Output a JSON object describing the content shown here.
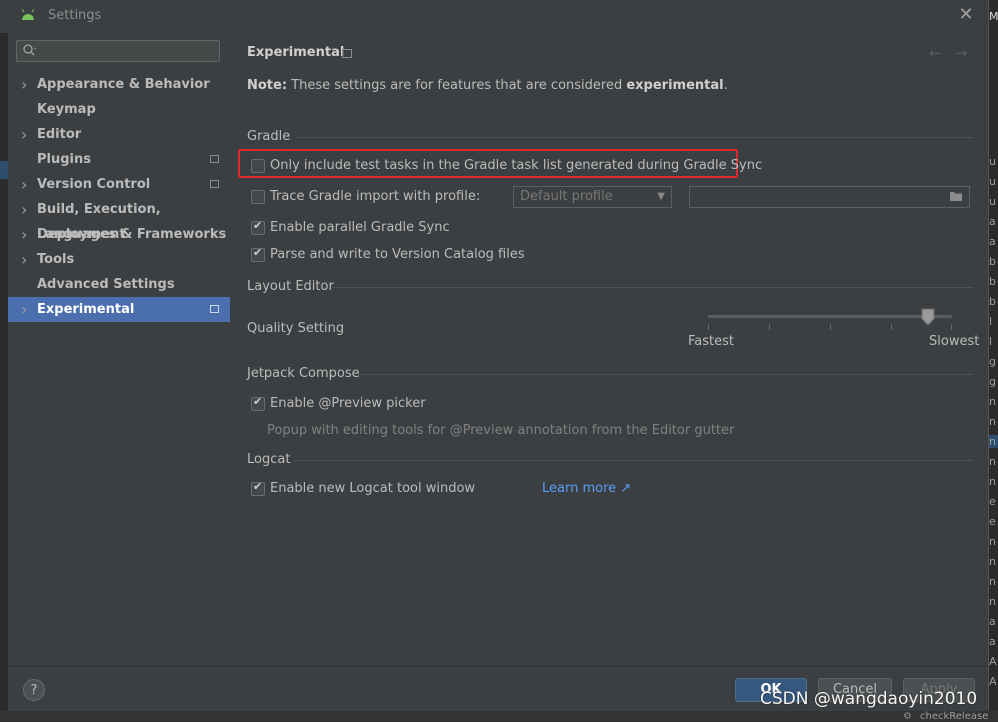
{
  "window": {
    "title": "Settings"
  },
  "sidebar": {
    "search_placeholder": "",
    "items": [
      {
        "label": "Appearance & Behavior",
        "expandable": true,
        "project": false
      },
      {
        "label": "Keymap",
        "expandable": false,
        "project": false
      },
      {
        "label": "Editor",
        "expandable": true,
        "project": false
      },
      {
        "label": "Plugins",
        "expandable": false,
        "project": true
      },
      {
        "label": "Version Control",
        "expandable": true,
        "project": true
      },
      {
        "label": "Build, Execution, Deployment",
        "expandable": true,
        "project": false
      },
      {
        "label": "Languages & Frameworks",
        "expandable": true,
        "project": false
      },
      {
        "label": "Tools",
        "expandable": true,
        "project": false
      },
      {
        "label": "Advanced Settings",
        "expandable": false,
        "project": false
      },
      {
        "label": "Experimental",
        "expandable": true,
        "project": true,
        "selected": true
      }
    ]
  },
  "page": {
    "title": "Experimental",
    "note_label": "Note:",
    "note_text": " These settings are for features that are considered ",
    "note_emph": "experimental",
    "note_end": "."
  },
  "gradle": {
    "section": "Gradle",
    "only_test_tasks": {
      "label": "Only include test tasks in the Gradle task list generated during Gradle Sync",
      "checked": false
    },
    "trace_import": {
      "label": "Trace Gradle import with profile:",
      "checked": false
    },
    "profile_dropdown": "Default profile",
    "profile_path": "",
    "parallel_sync": {
      "label": "Enable parallel Gradle Sync",
      "checked": true
    },
    "version_catalog": {
      "label": "Parse and write to Version Catalog files",
      "checked": true
    }
  },
  "layout_editor": {
    "section": "Layout Editor",
    "quality_label": "Quality Setting",
    "slider_min_label": "Fastest",
    "slider_max_label": "Slowest",
    "slider_value_fraction": 0.9
  },
  "compose": {
    "section": "Jetpack Compose",
    "preview_picker": {
      "label": "Enable @Preview picker",
      "checked": true
    },
    "preview_desc": "Popup with editing tools for @Preview annotation from the Editor gutter"
  },
  "logcat": {
    "section": "Logcat",
    "new_logcat": {
      "label": "Enable new Logcat tool window",
      "checked": true
    },
    "learn_more": "Learn more ↗"
  },
  "footer": {
    "help": "?",
    "ok": "OK",
    "cancel": "Cancel",
    "apply": "Apply"
  },
  "background_strip": {
    "bottom_text": "checkRelease"
  },
  "watermark": "CSDN @wangdaoyin2010",
  "colors": {
    "accent": "#4b6eaf",
    "highlight_box": "#e0272a",
    "link": "#589df6",
    "ok_button": "#365880"
  }
}
